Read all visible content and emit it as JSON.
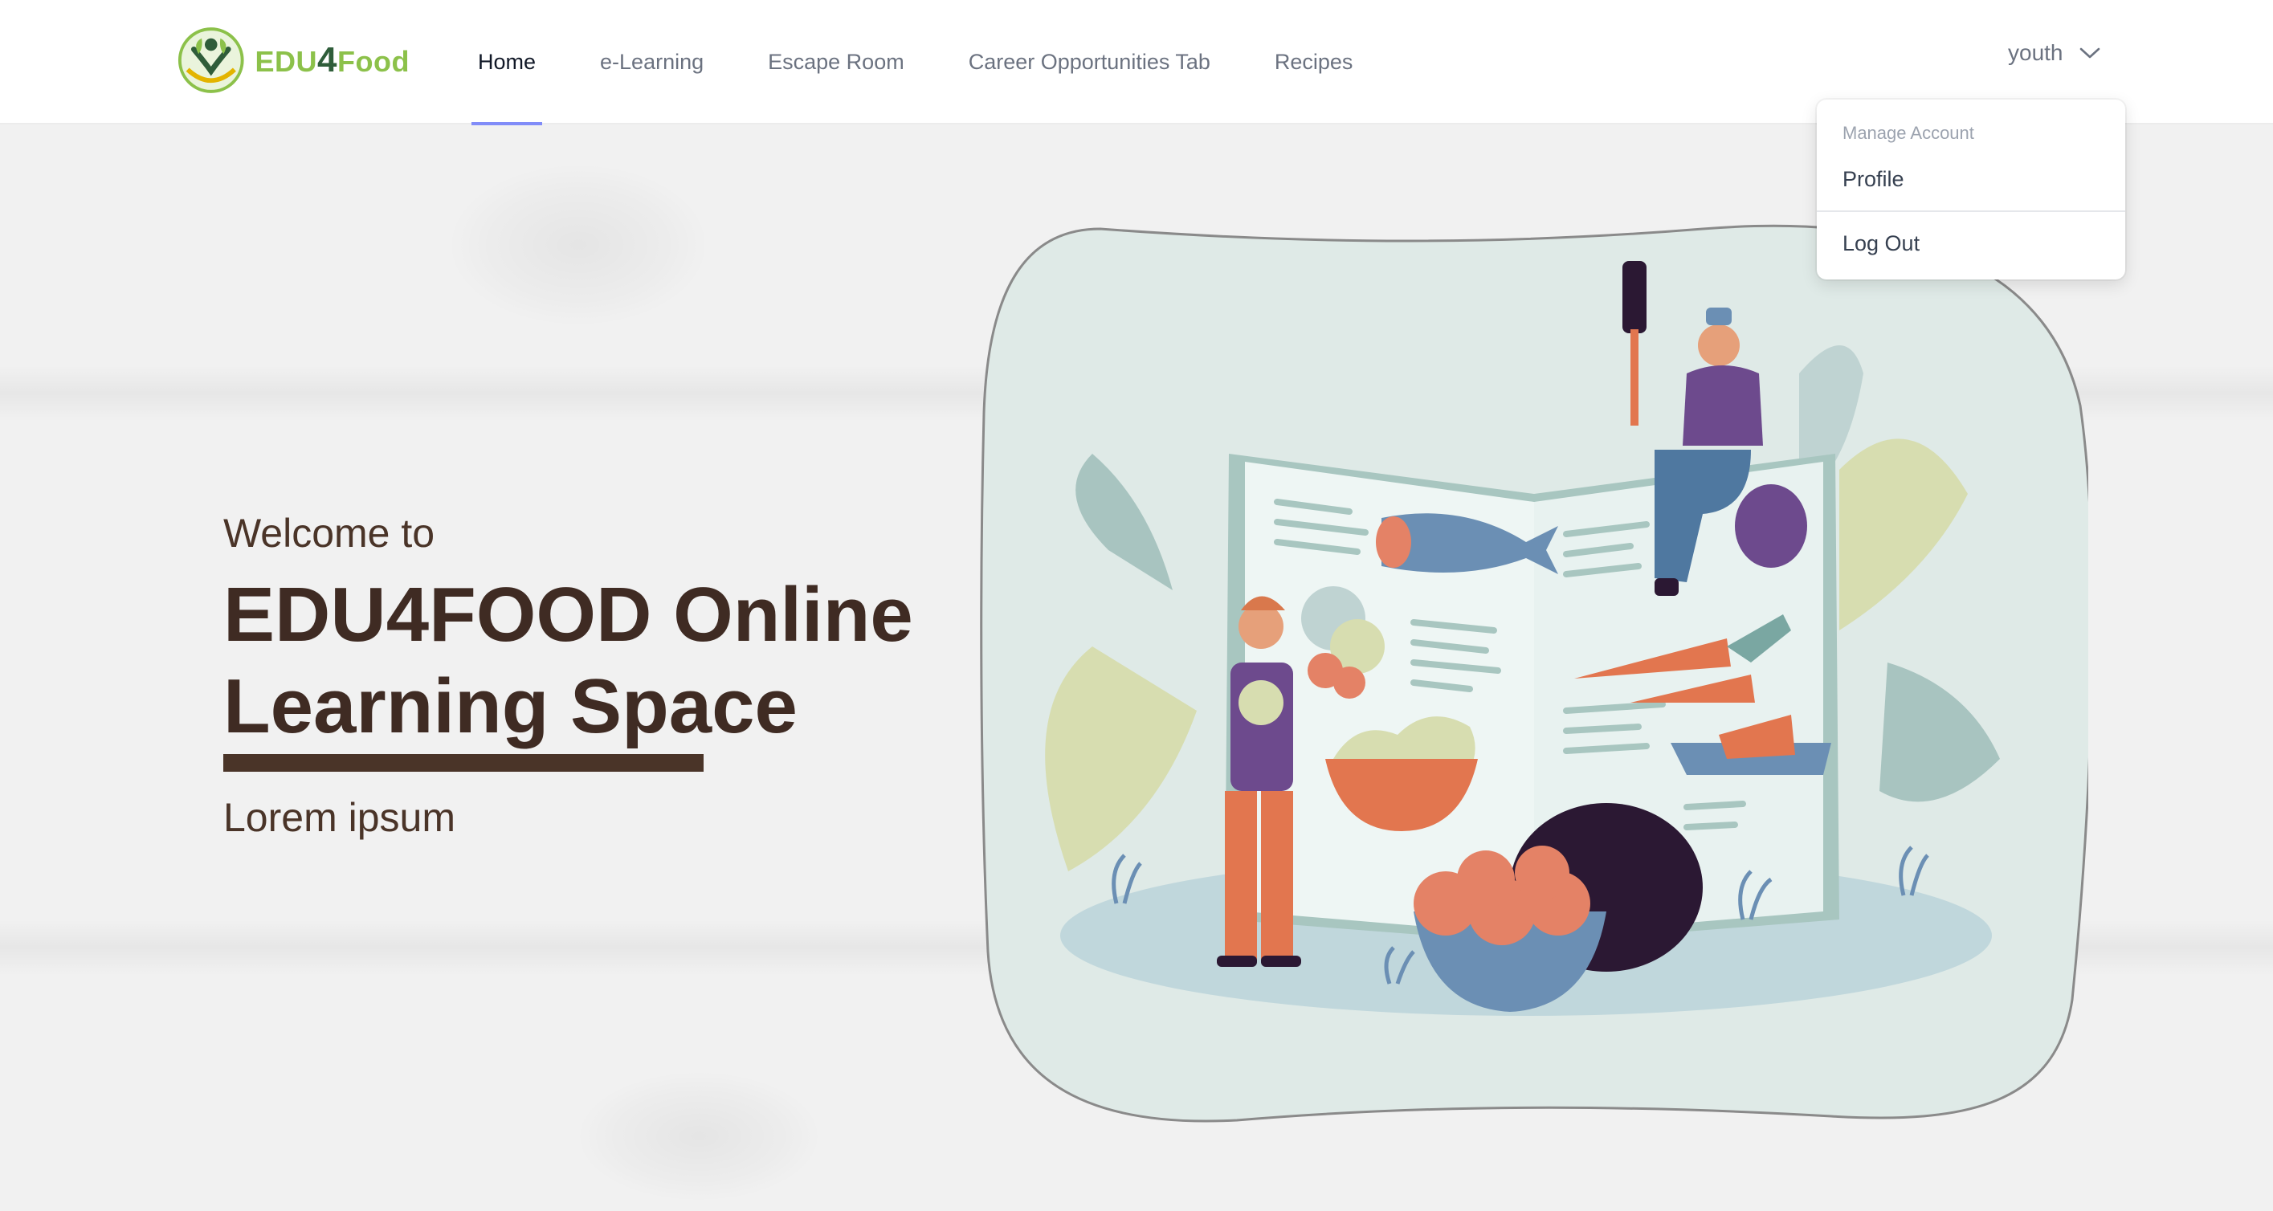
{
  "brand": {
    "logo_text_left": "EDU",
    "logo_text_mid": "4",
    "logo_text_right": "Food",
    "colors": {
      "green": "#8cc14a",
      "dark_green": "#2f5d3a"
    }
  },
  "nav": {
    "links": [
      {
        "label": "Home",
        "active": true
      },
      {
        "label": "e-Learning",
        "active": false
      },
      {
        "label": "Escape Room",
        "active": false
      },
      {
        "label": "Career Opportunities Tab",
        "active": false
      },
      {
        "label": "Recipes",
        "active": false
      }
    ],
    "active_underline_color": "#818cf8"
  },
  "user_menu": {
    "username": "youth",
    "icon": "chevron-down-icon",
    "dropdown": {
      "header": "Manage Account",
      "items": [
        "Profile",
        "Log Out"
      ]
    }
  },
  "hero": {
    "welcome": "Welcome to",
    "title_line1": "EDU4FOOD Online",
    "title_line2": "Learning Space",
    "subtitle": "Lorem ipsum",
    "text_color": "#4a3428"
  }
}
